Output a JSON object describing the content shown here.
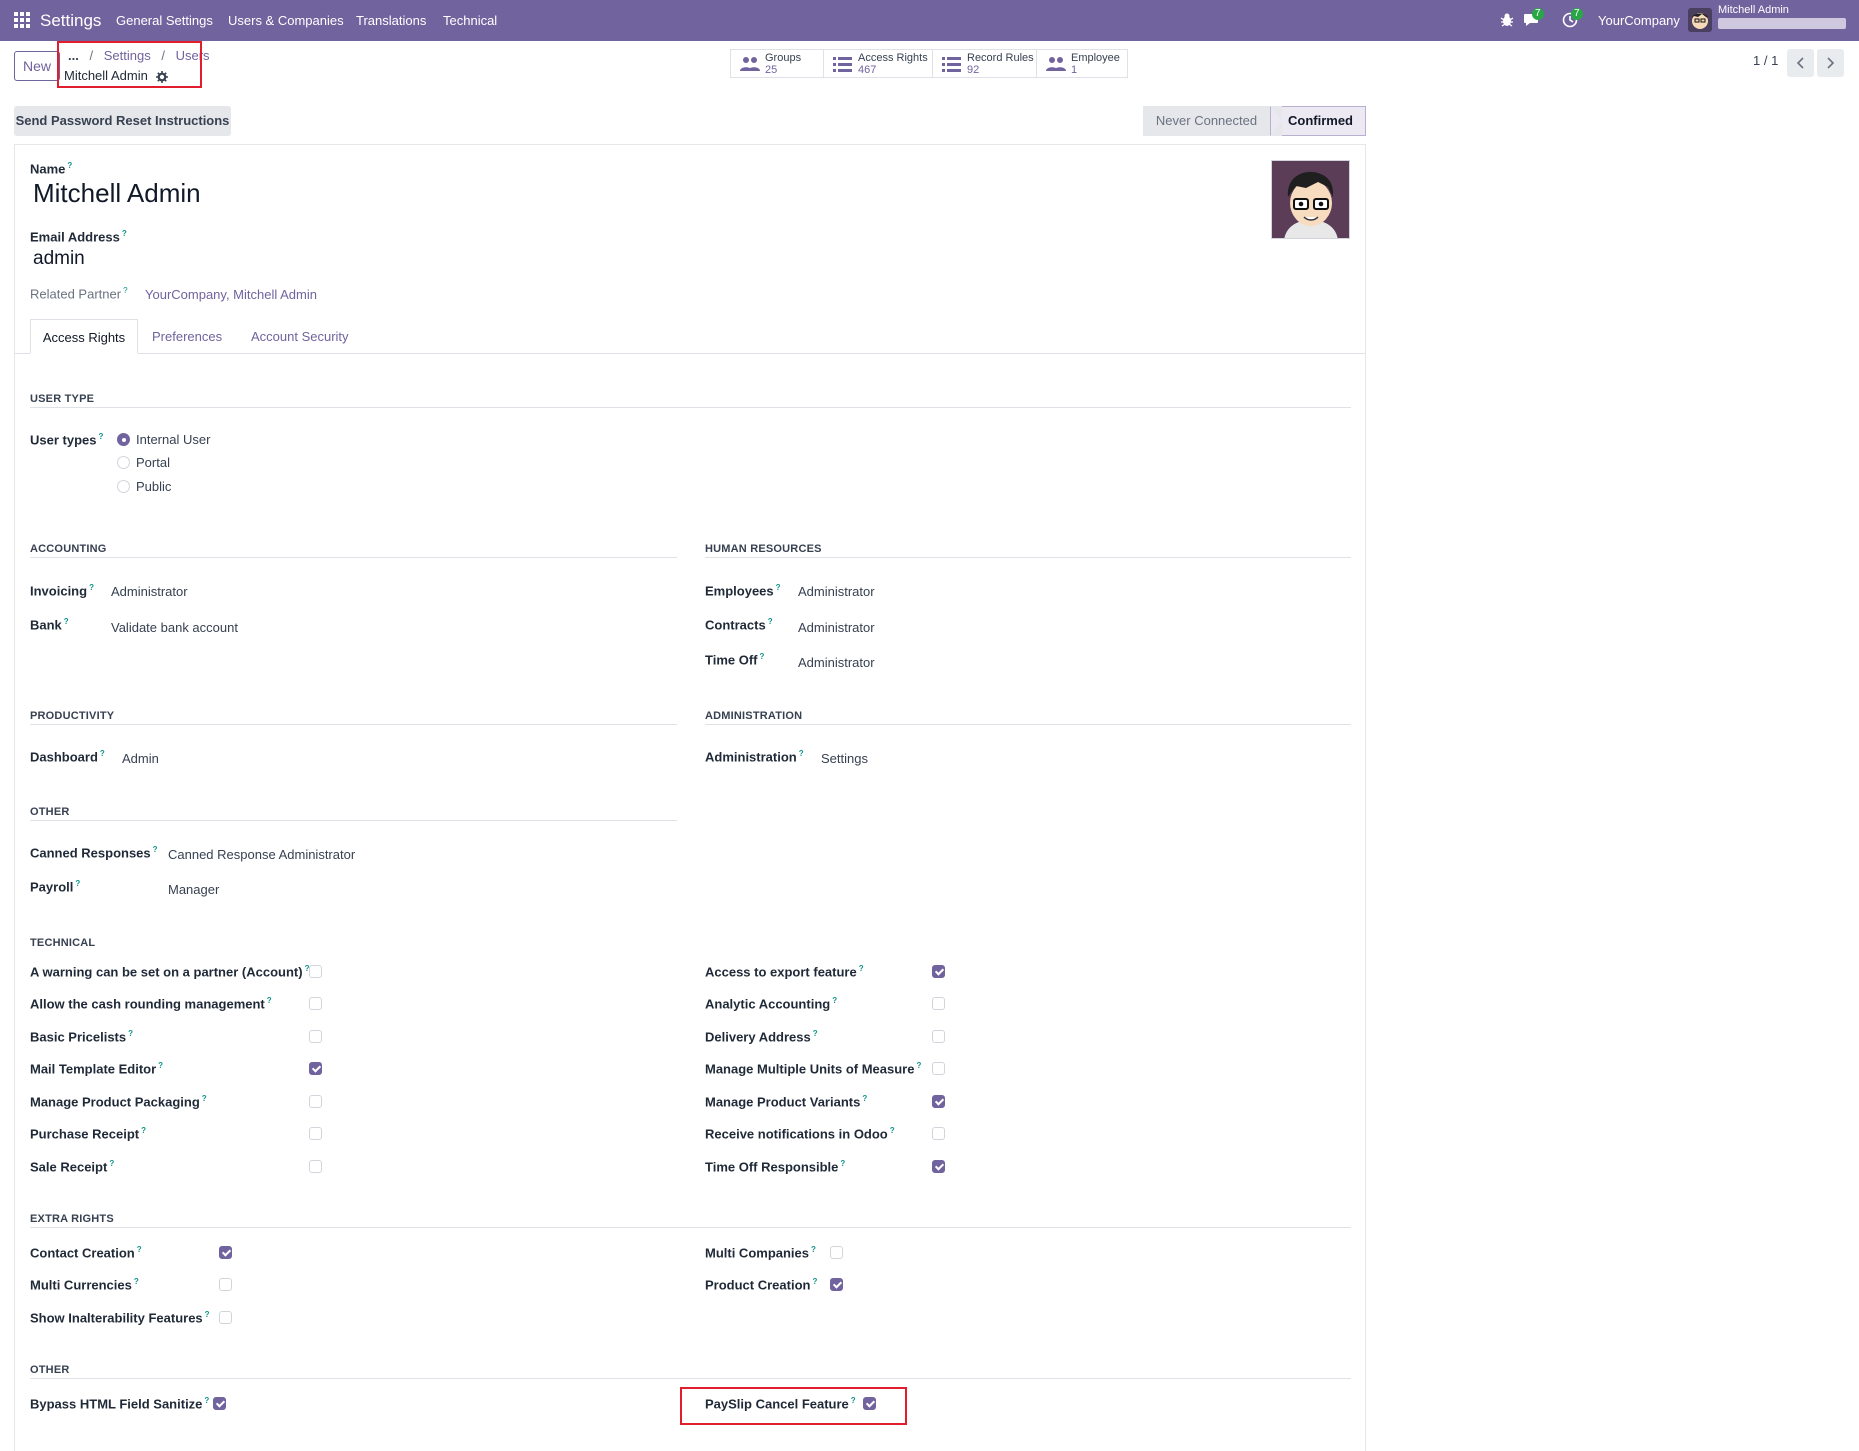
{
  "navbar": {
    "app": "Settings",
    "menus": [
      "General Settings",
      "Users & Companies",
      "Translations",
      "Technical"
    ],
    "messages_badge": "7",
    "activities_badge": "7",
    "company": "YourCompany",
    "user": "Mitchell Admin"
  },
  "control": {
    "new_label": "New",
    "breadcrumb": [
      "...",
      "Settings",
      "Users"
    ],
    "record_title": "Mitchell Admin",
    "stats": [
      {
        "label": "Groups",
        "value": "25",
        "icon": "users-icon"
      },
      {
        "label": "Access Rights",
        "value": "467",
        "icon": "list-icon"
      },
      {
        "label": "Record Rules",
        "value": "92",
        "icon": "list-icon"
      },
      {
        "label": "Employee",
        "value": "1",
        "icon": "users-icon"
      }
    ],
    "pager": "1 / 1"
  },
  "status": {
    "reset_button": "Send Password Reset Instructions",
    "stages": [
      "Never Connected",
      "Confirmed"
    ],
    "current": "Confirmed"
  },
  "form": {
    "name_label": "Name",
    "name": "Mitchell Admin",
    "email_label": "Email Address",
    "email": "admin",
    "partner_label": "Related Partner",
    "partner": "YourCompany, Mitchell Admin",
    "tabs": [
      "Access Rights",
      "Preferences",
      "Account Security"
    ],
    "active_tab": "Access Rights"
  },
  "user_type": {
    "section": "USER TYPE",
    "label": "User types",
    "options": [
      "Internal User",
      "Portal",
      "Public"
    ],
    "selected": "Internal User"
  },
  "accounting": {
    "section": "ACCOUNTING",
    "rows": [
      {
        "label": "Invoicing",
        "value": "Administrator"
      },
      {
        "label": "Bank",
        "value": "Validate bank account"
      }
    ]
  },
  "hr": {
    "section": "HUMAN RESOURCES",
    "rows": [
      {
        "label": "Employees",
        "value": "Administrator"
      },
      {
        "label": "Contracts",
        "value": "Administrator"
      },
      {
        "label": "Time Off",
        "value": "Administrator"
      }
    ]
  },
  "productivity": {
    "section": "PRODUCTIVITY",
    "rows": [
      {
        "label": "Dashboard",
        "value": "Admin"
      }
    ]
  },
  "administration": {
    "section": "ADMINISTRATION",
    "rows": [
      {
        "label": "Administration",
        "value": "Settings"
      }
    ]
  },
  "other1": {
    "section": "OTHER",
    "rows": [
      {
        "label": "Canned Responses",
        "value": "Canned Response Administrator"
      },
      {
        "label": "Payroll",
        "value": "Manager"
      }
    ]
  },
  "technical": {
    "section": "TECHNICAL",
    "left": [
      {
        "label": "A warning can be set on a partner (Account)",
        "checked": false
      },
      {
        "label": "Allow the cash rounding management",
        "checked": false
      },
      {
        "label": "Basic Pricelists",
        "checked": false
      },
      {
        "label": "Mail Template Editor",
        "checked": true
      },
      {
        "label": "Manage Product Packaging",
        "checked": false
      },
      {
        "label": "Purchase Receipt",
        "checked": false
      },
      {
        "label": "Sale Receipt",
        "checked": false
      }
    ],
    "right": [
      {
        "label": "Access to export feature",
        "checked": true
      },
      {
        "label": "Analytic Accounting",
        "checked": false
      },
      {
        "label": "Delivery Address",
        "checked": false
      },
      {
        "label": "Manage Multiple Units of Measure",
        "checked": false
      },
      {
        "label": "Manage Product Variants",
        "checked": true
      },
      {
        "label": "Receive notifications in Odoo",
        "checked": false
      },
      {
        "label": "Time Off Responsible",
        "checked": true
      }
    ]
  },
  "extra": {
    "section": "EXTRA RIGHTS",
    "left": [
      {
        "label": "Contact Creation",
        "checked": true
      },
      {
        "label": "Multi Currencies",
        "checked": false
      },
      {
        "label": "Show Inalterability Features",
        "checked": false
      }
    ],
    "right": [
      {
        "label": "Multi Companies",
        "checked": false
      },
      {
        "label": "Product Creation",
        "checked": true
      }
    ]
  },
  "other2": {
    "section": "OTHER",
    "left": [
      {
        "label": "Bypass HTML Field Sanitize",
        "checked": true
      }
    ],
    "right": [
      {
        "label": "PaySlip Cancel Feature",
        "checked": true
      }
    ]
  },
  "colors": {
    "brand": "#71639e",
    "highlight": "#e11d2e"
  }
}
